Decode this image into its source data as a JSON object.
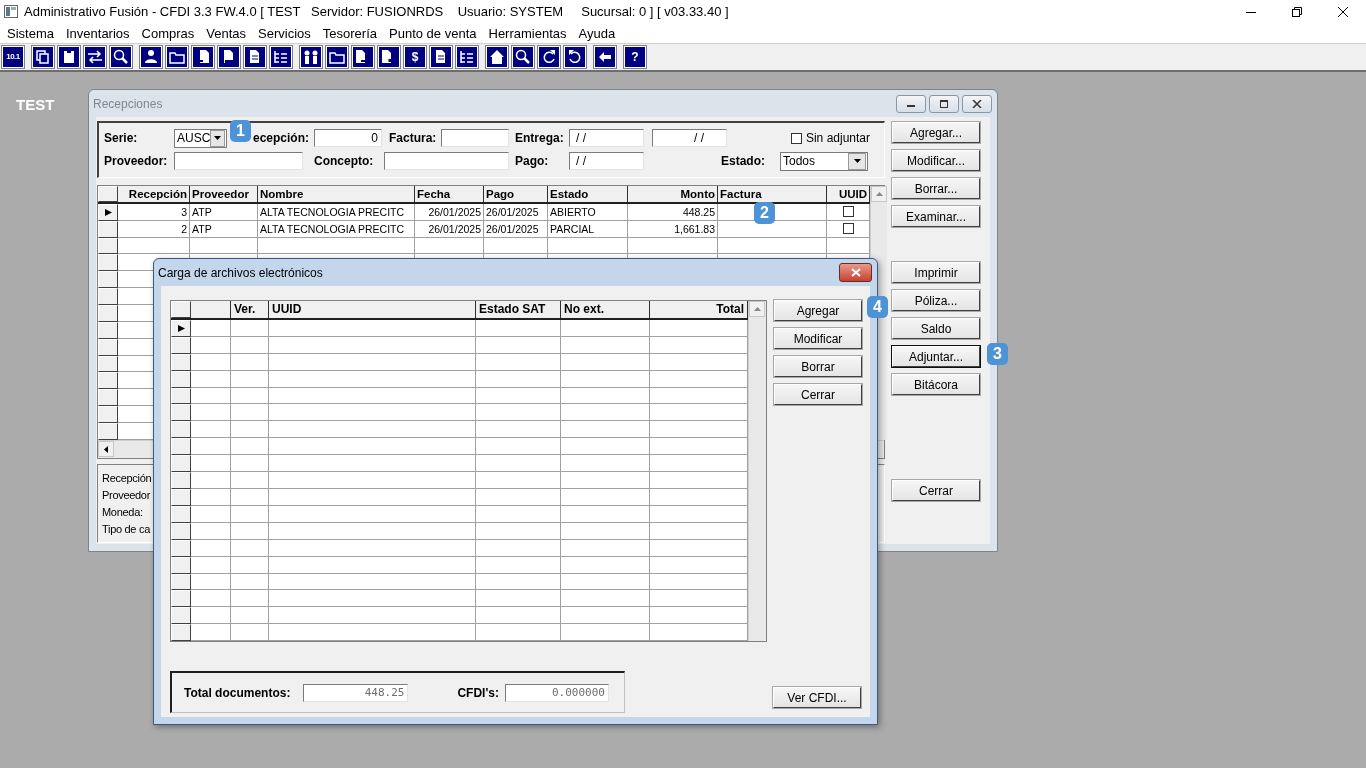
{
  "app": {
    "title": "Administrativo Fusión - CFDI 3.3 FW.4.0 [ TEST   Servidor: FUSIONRDS    Usuario: SYSTEM     Sucursal: 0 ] [ v03.33.40 ]"
  },
  "menu": [
    "Sistema",
    "Inventarios",
    "Compras",
    "Ventas",
    "Servicios",
    "Tesorería",
    "Punto de venta",
    "Herramientas",
    "Ayuda"
  ],
  "toolbar": [
    [
      {
        "kind": "text",
        "label": "10.1"
      }
    ],
    [
      {
        "kind": "copy"
      },
      {
        "kind": "clipboard"
      },
      {
        "kind": "swap"
      },
      {
        "kind": "zoom"
      }
    ],
    [
      {
        "kind": "person"
      },
      {
        "kind": "folder"
      },
      {
        "kind": "doc-left"
      },
      {
        "kind": "doc-minus"
      },
      {
        "kind": "doc"
      },
      {
        "kind": "tree"
      }
    ],
    [
      {
        "kind": "people"
      },
      {
        "kind": "folder"
      },
      {
        "kind": "doc-right"
      },
      {
        "kind": "doc-plus"
      },
      {
        "kind": "text",
        "label": "$"
      },
      {
        "kind": "doc"
      },
      {
        "kind": "tree"
      }
    ],
    [
      {
        "kind": "home"
      },
      {
        "kind": "zoom"
      },
      {
        "kind": "refresh"
      },
      {
        "kind": "undo"
      }
    ],
    [
      {
        "kind": "left"
      }
    ],
    [
      {
        "kind": "text",
        "label": "?"
      }
    ]
  ],
  "desktop_label": "TEST",
  "recepciones": {
    "title": "Recepciones",
    "active": false,
    "filters": [
      [
        {
          "kind": "label",
          "text": "Serie:"
        },
        {
          "kind": "combo",
          "value": "AUSC"
        },
        {
          "kind": "label",
          "text": "ecepción:"
        },
        {
          "kind": "text",
          "value": "0"
        },
        {
          "kind": "label",
          "text": "Factura:"
        },
        {
          "kind": "text"
        },
        {
          "kind": "label",
          "text": "Entrega:"
        },
        {
          "kind": "date",
          "value": "/ /"
        },
        {
          "kind": "date",
          "value": "/ /"
        },
        {
          "kind": "check",
          "label": "Sin adjuntar",
          "checked": false
        }
      ],
      [
        {
          "kind": "label",
          "text": "Proveedor:"
        },
        {
          "kind": "text"
        },
        {
          "kind": "label",
          "text": "Concepto:"
        },
        {
          "kind": "text"
        },
        {
          "kind": "label",
          "text": "Pago:"
        },
        {
          "kind": "date",
          "value": "/ /"
        },
        {
          "kind": "label",
          "text": "Estado:"
        },
        {
          "kind": "combo",
          "value": "Todos"
        }
      ]
    ],
    "grid": {
      "columns": [
        {
          "label": "Recepción",
          "kind": "text"
        },
        {
          "label": "Proveedor",
          "kind": "text"
        },
        {
          "label": "Nombre",
          "kind": "text"
        },
        {
          "label": "Fecha",
          "kind": "text"
        },
        {
          "label": "Pago",
          "kind": "text"
        },
        {
          "label": "Estado",
          "kind": "text"
        },
        {
          "label": "Monto",
          "kind": "text"
        },
        {
          "label": "Factura",
          "kind": "text"
        },
        {
          "label": "UUID",
          "kind": "check"
        }
      ],
      "rows": [
        {
          "current": true,
          "cells": [
            "3",
            "ATP",
            "ALTA TECNOLOGIA PRECITC",
            "26/01/2025",
            "26/01/2025",
            "ABIERTO",
            "448.25"
          ],
          "uuid_checked": false
        },
        {
          "current": false,
          "cells": [
            "2",
            "ATP",
            "ALTA TECNOLOGIA PRECITC",
            "26/01/2025",
            "26/01/2025",
            "PARCIAL",
            "1,661.83"
          ],
          "uuid_checked": false
        }
      ]
    },
    "button_groups": [
      [
        {
          "label": "Agregar...",
          "focused": false
        },
        {
          "label": "Modificar...",
          "focused": false
        },
        {
          "label": "Borrar...",
          "focused": false
        },
        {
          "label": "Examinar...",
          "focused": false
        }
      ],
      [
        {
          "label": "Imprimir",
          "focused": false
        },
        {
          "label": "Póliza...",
          "focused": false
        },
        {
          "label": "Saldo",
          "focused": false
        },
        {
          "label": "Adjuntar...",
          "focused": true
        },
        {
          "label": "Bitácora",
          "focused": false
        }
      ],
      [
        {
          "label": "Cerrar",
          "focused": false
        }
      ]
    ],
    "info_labels": [
      "Recepción",
      "Proveedor",
      "Moneda:",
      "Tipo de ca"
    ]
  },
  "dialog": {
    "title": "Carga de archivos electrónicos",
    "active": true,
    "grid": {
      "columns": [
        "Ver.",
        "UUID",
        "Estado SAT",
        "No ext.",
        "Total"
      ],
      "rows": [
        {
          "current": true
        }
      ]
    },
    "buttons": [
      "Agregar",
      "Modificar",
      "Borrar",
      "Cerrar"
    ],
    "totals": [
      {
        "label": "Total documentos:",
        "value": "448.25"
      },
      {
        "label": "CFDI's:",
        "value": "0.000000"
      }
    ],
    "view_button": "Ver CFDI..."
  },
  "annotations": [
    {
      "label": "1"
    },
    {
      "label": "2"
    },
    {
      "label": "3"
    },
    {
      "label": "4"
    }
  ]
}
